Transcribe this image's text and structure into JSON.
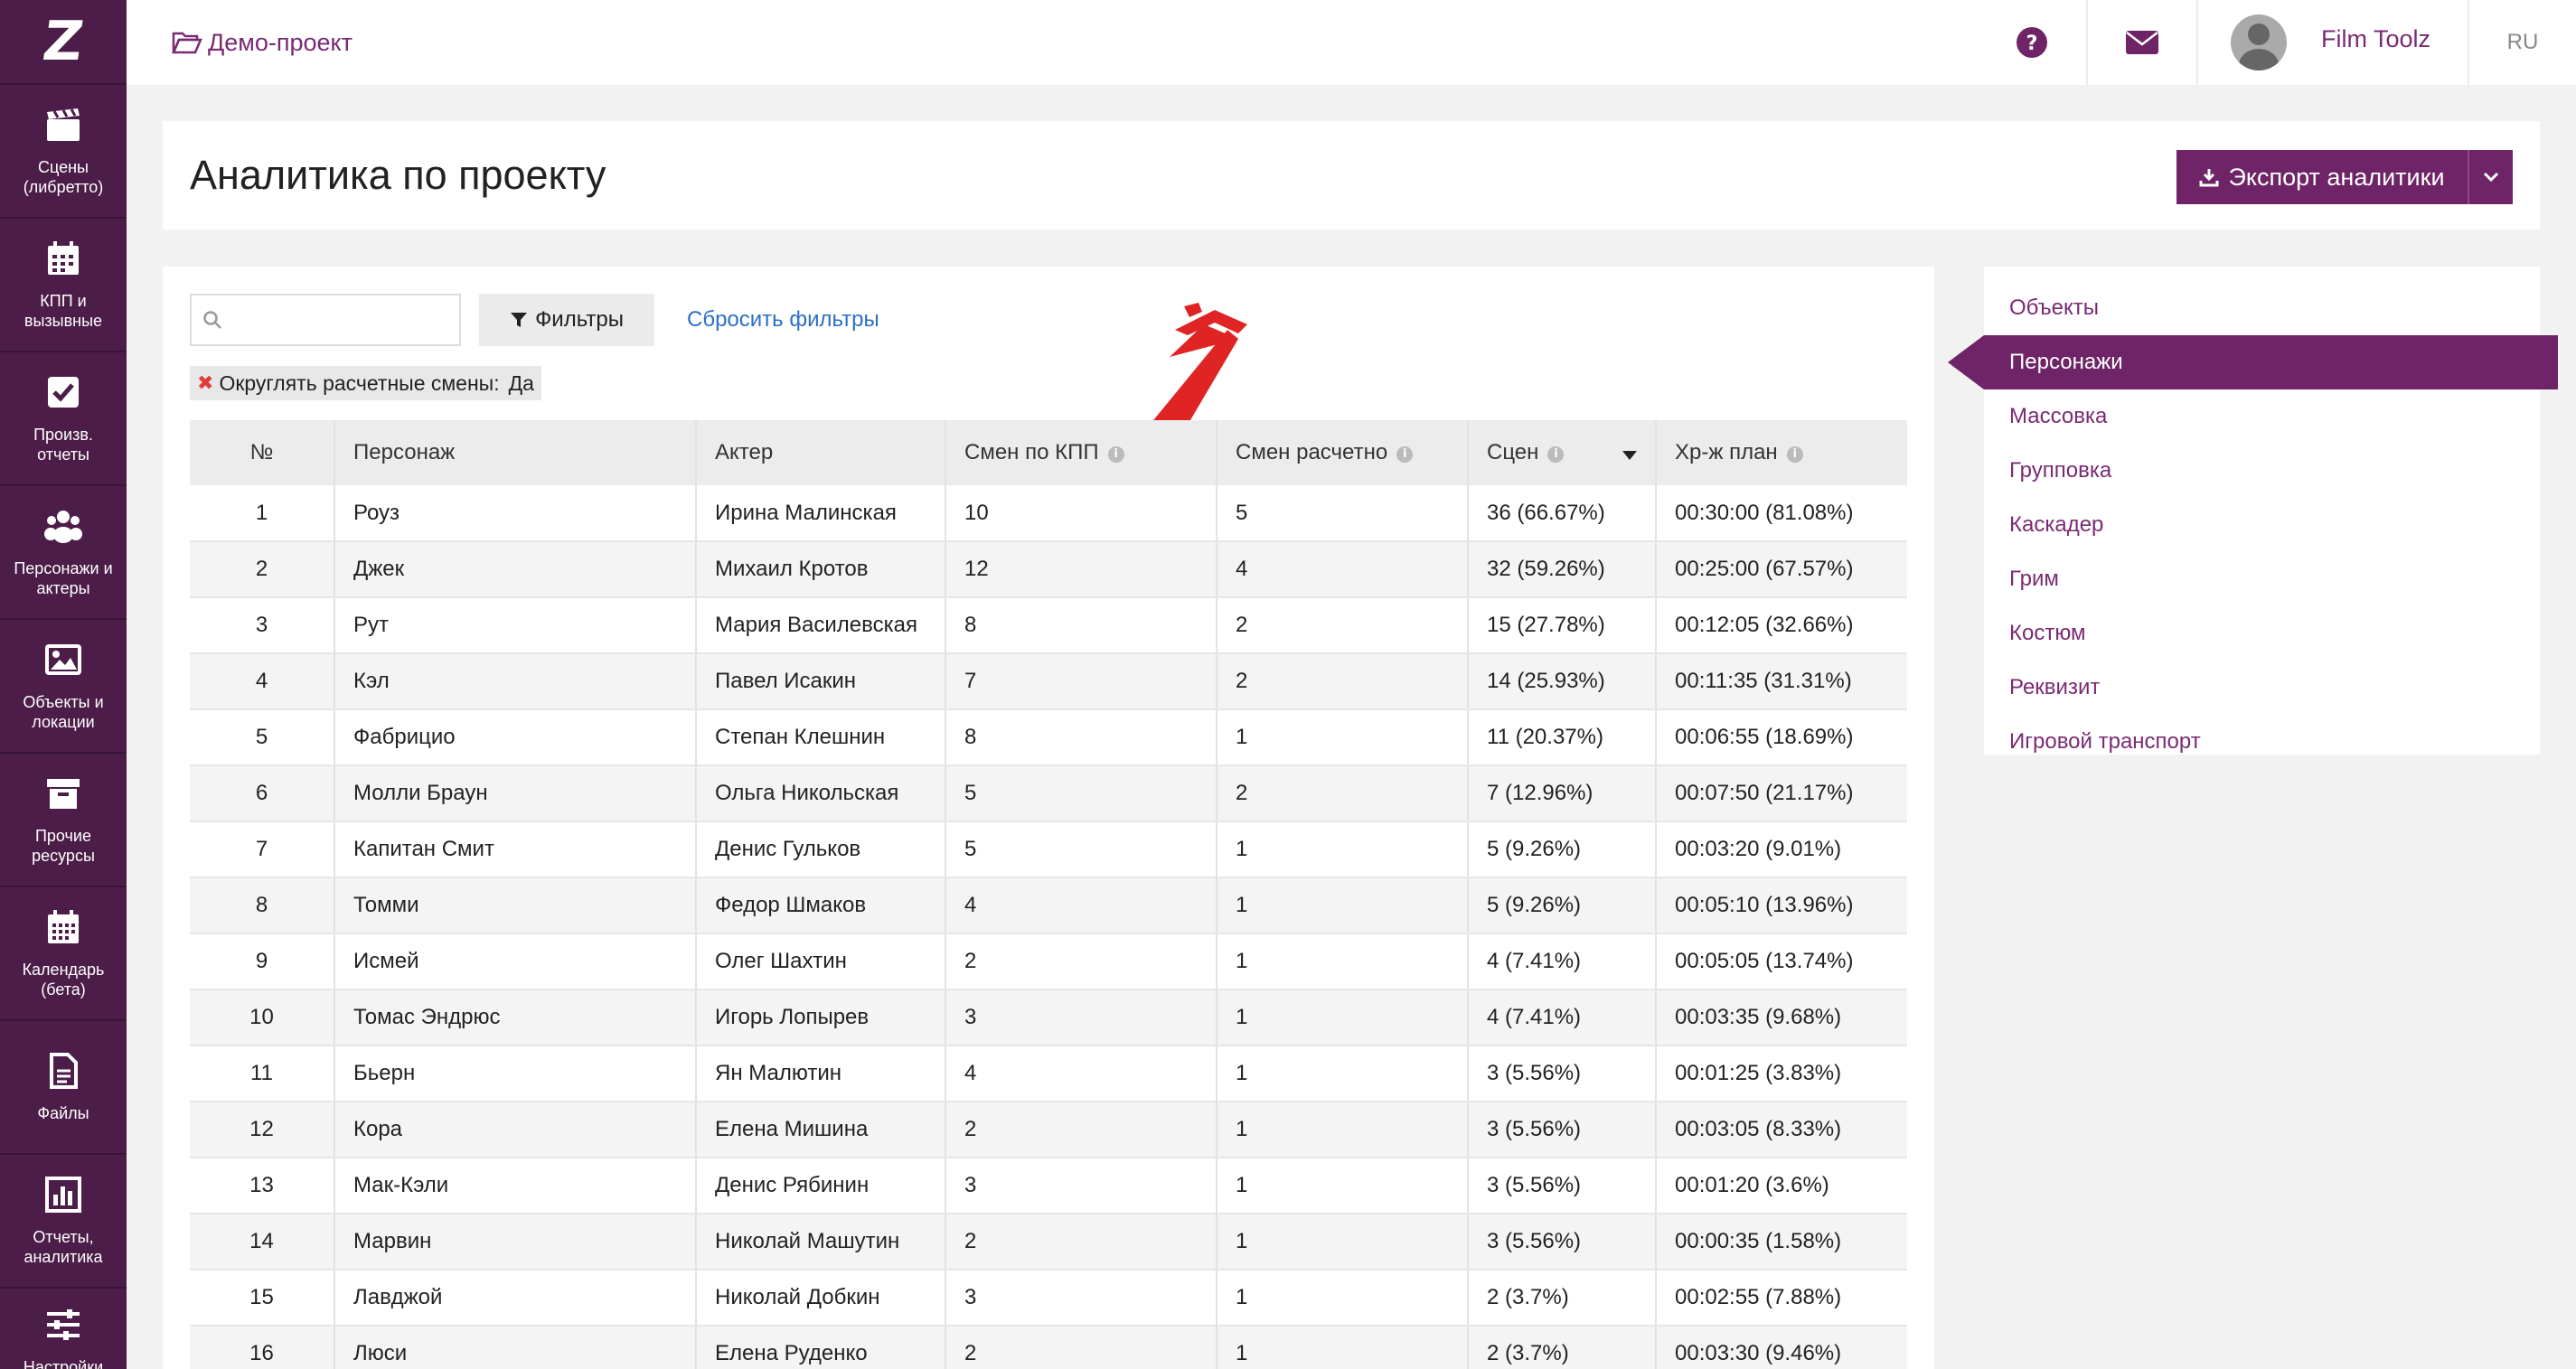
{
  "brand": {
    "logo": "Z"
  },
  "sidebar": {
    "items": [
      {
        "label": "Сцены (либретто)",
        "icon": "clapperboard-icon"
      },
      {
        "label": "КПП и вызывные",
        "icon": "calendar-icon"
      },
      {
        "label": "Произв. отчеты",
        "icon": "checkbox-icon"
      },
      {
        "label": "Персонажи и актеры",
        "icon": "users-icon"
      },
      {
        "label": "Объекты и локации",
        "icon": "image-icon"
      },
      {
        "label": "Прочие ресурсы",
        "icon": "archive-box-icon"
      },
      {
        "label": "Календарь (бета)",
        "icon": "calendar-grid-icon"
      },
      {
        "label": "Файлы",
        "icon": "file-icon"
      },
      {
        "label": "Отчеты, аналитика",
        "icon": "bar-chart-icon"
      },
      {
        "label": "Настройки",
        "icon": "sliders-icon"
      }
    ]
  },
  "topbar": {
    "breadcrumb": "Демо-проект",
    "username": "Film Toolz",
    "lang": "RU"
  },
  "header": {
    "title": "Аналитика по проекту",
    "export_label": "Экспорт аналитики"
  },
  "filters": {
    "search_placeholder": "",
    "filter_label": "Фильтры",
    "reset_label": "Сбросить фильтры",
    "chip_label": "Округлять расчетные смены:",
    "chip_value": "Да"
  },
  "table": {
    "columns": [
      "№",
      "Персонаж",
      "Актер",
      "Смен по КПП",
      "Смен расчетно",
      "Сцен",
      "Хр-ж план"
    ],
    "rows": [
      [
        "1",
        "Роуз",
        "Ирина Малинская",
        "10",
        "5",
        "36 (66.67%)",
        "00:30:00 (81.08%)"
      ],
      [
        "2",
        "Джек",
        "Михаил Кротов",
        "12",
        "4",
        "32 (59.26%)",
        "00:25:00 (67.57%)"
      ],
      [
        "3",
        "Рут",
        "Мария Василевская",
        "8",
        "2",
        "15 (27.78%)",
        "00:12:05 (32.66%)"
      ],
      [
        "4",
        "Кэл",
        "Павел Исакин",
        "7",
        "2",
        "14 (25.93%)",
        "00:11:35 (31.31%)"
      ],
      [
        "5",
        "Фабрицио",
        "Степан Клешнин",
        "8",
        "1",
        "11 (20.37%)",
        "00:06:55 (18.69%)"
      ],
      [
        "6",
        "Молли Браун",
        "Ольга Никольская",
        "5",
        "2",
        "7 (12.96%)",
        "00:07:50 (21.17%)"
      ],
      [
        "7",
        "Капитан Смит",
        "Денис Гульков",
        "5",
        "1",
        "5 (9.26%)",
        "00:03:20 (9.01%)"
      ],
      [
        "8",
        "Томми",
        "Федор Шмаков",
        "4",
        "1",
        "5 (9.26%)",
        "00:05:10 (13.96%)"
      ],
      [
        "9",
        "Исмей",
        "Олег Шахтин",
        "2",
        "1",
        "4 (7.41%)",
        "00:05:05 (13.74%)"
      ],
      [
        "10",
        "Томас Эндрюс",
        "Игорь Лопырев",
        "3",
        "1",
        "4 (7.41%)",
        "00:03:35 (9.68%)"
      ],
      [
        "11",
        "Бьерн",
        "Ян Малютин",
        "4",
        "1",
        "3 (5.56%)",
        "00:01:25 (3.83%)"
      ],
      [
        "12",
        "Кора",
        "Елена Мишина",
        "2",
        "1",
        "3 (5.56%)",
        "00:03:05 (8.33%)"
      ],
      [
        "13",
        "Мак-Кэли",
        "Денис Рябинин",
        "3",
        "1",
        "3 (5.56%)",
        "00:01:20 (3.6%)"
      ],
      [
        "14",
        "Марвин",
        "Николай Машутин",
        "2",
        "1",
        "3 (5.56%)",
        "00:00:35 (1.58%)"
      ],
      [
        "15",
        "Лавджой",
        "Николай Добкин",
        "3",
        "1",
        "2 (3.7%)",
        "00:02:55 (7.88%)"
      ],
      [
        "16",
        "Люси",
        "Елена Руденко",
        "2",
        "1",
        "2 (3.7%)",
        "00:03:30 (9.46%)"
      ]
    ]
  },
  "right_nav": {
    "active_index": 1,
    "items": [
      "Объекты",
      "Персонажи",
      "Массовка",
      "Групповка",
      "Каскадер",
      "Грим",
      "Костюм",
      "Реквизит",
      "Игровой транспорт"
    ]
  },
  "colors": {
    "sidebar_bg": "#4c1d48",
    "accent": "#6e2466",
    "link": "#2c6fc7",
    "arrow": "#e02424"
  }
}
